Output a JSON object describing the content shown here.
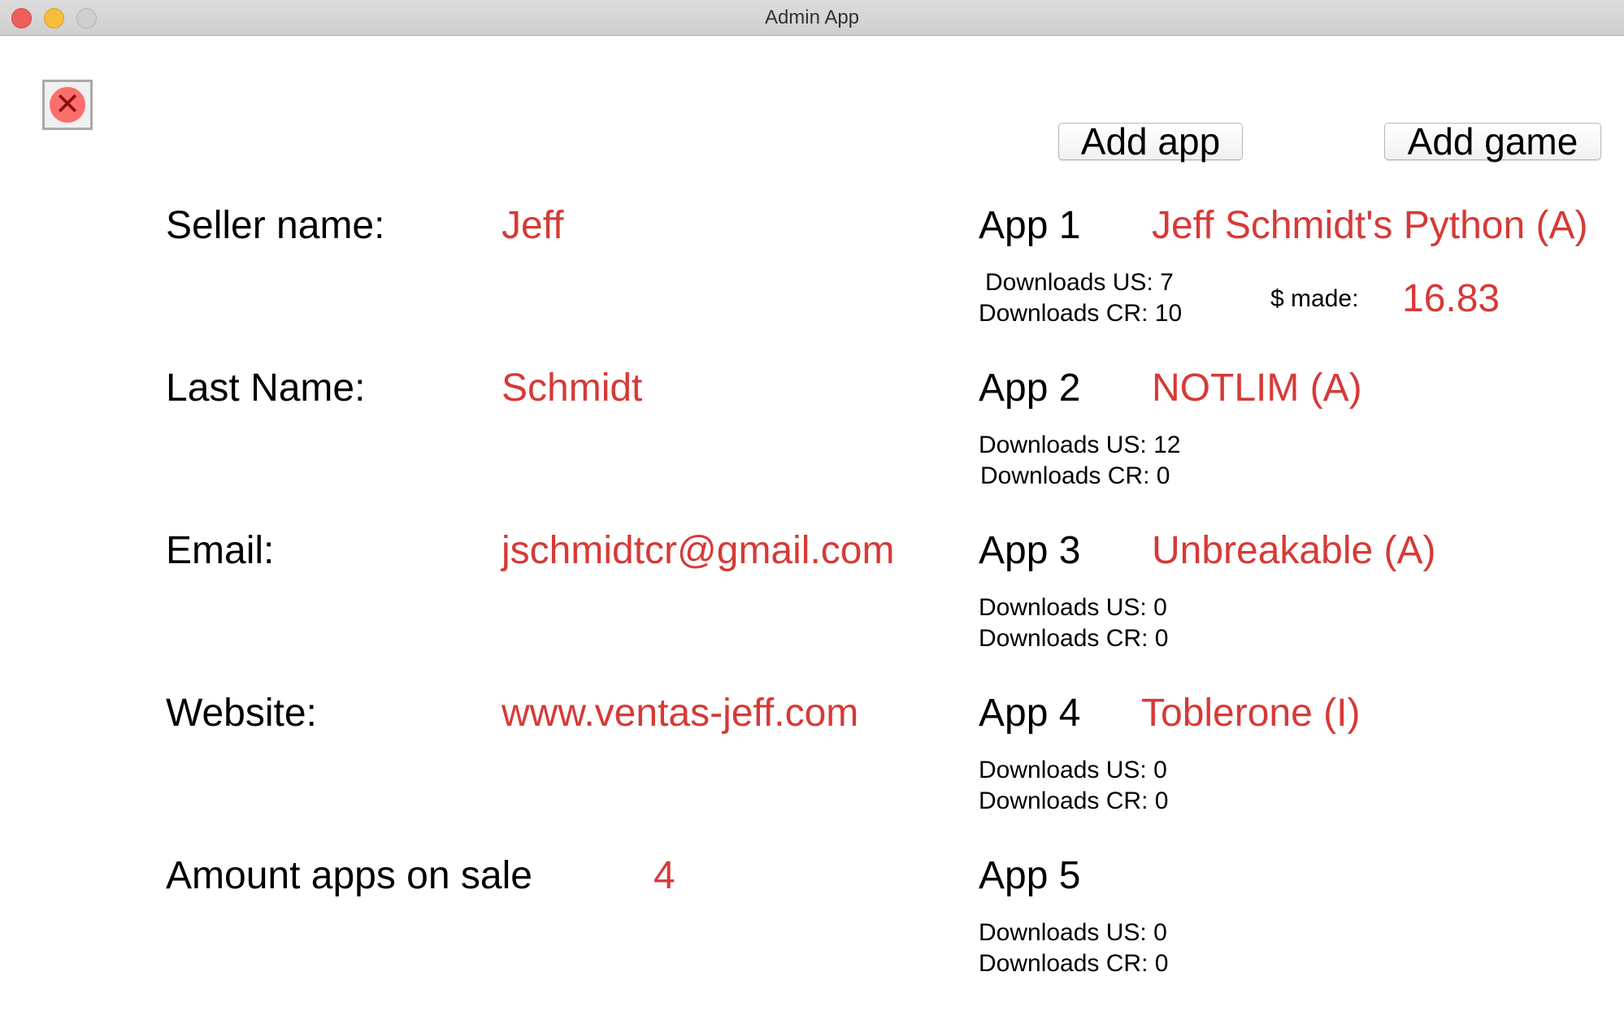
{
  "window": {
    "title": "Admin App"
  },
  "toolbar": {
    "close_icon": "red-circle-x-icon",
    "add_app_label": "Add app",
    "add_game_label": "Add game"
  },
  "seller": {
    "name_label": "Seller name:",
    "name": "Jeff",
    "last_name_label": "Last Name:",
    "last_name": "Schmidt",
    "email_label": "Email:",
    "email": "jschmidtcr@gmail.com",
    "website_label": "Website:",
    "website": "www.ventas-jeff.com",
    "amount_label": "Amount apps on sale",
    "amount": "4"
  },
  "apps": [
    {
      "label": "App 1",
      "name": "Jeff Schmidt's Python (A)",
      "downloads_us": "Downloads US: 7",
      "downloads_cr": "Downloads CR: 10",
      "made_label": "$ made:",
      "made": "16.83"
    },
    {
      "label": "App 2",
      "name": "NOTLIM (A)",
      "downloads_us": "Downloads US: 12",
      "downloads_cr": "Downloads CR:  0"
    },
    {
      "label": "App 3",
      "name": "Unbreakable (A)",
      "downloads_us": "Downloads US:  0",
      "downloads_cr": "Downloads CR:  0"
    },
    {
      "label": "App 4",
      "name": "Toblerone (I)",
      "downloads_us": "Downloads US: 0",
      "downloads_cr": "Downloads CR: 0"
    },
    {
      "label": "App 5",
      "name": "",
      "downloads_us": "Downloads US: 0",
      "downloads_cr": "Downloads CR: 0"
    }
  ],
  "colors": {
    "value": "#d63a37"
  }
}
